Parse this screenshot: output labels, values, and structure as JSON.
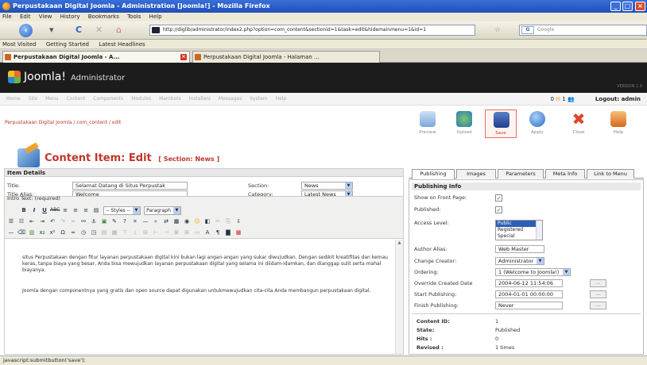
{
  "window": {
    "title": "Perpustakaan Digital Joomla - Administration [Joomla!] - Mozilla Firefox"
  },
  "menubar": [
    "File",
    "Edit",
    "View",
    "History",
    "Bookmarks",
    "Tools",
    "Help"
  ],
  "nav": {
    "url": "http://diglib/administrator/index2.php?option=com_content&sectionid=1&task=edit&hidemainmenu=1&id=1",
    "search_placeholder": "Google"
  },
  "bookmarks": [
    "Most Visited",
    "Getting Started",
    "Latest Headlines"
  ],
  "tabs": [
    {
      "label": "Perpustakaan Digital Joomla - A..."
    },
    {
      "label": "Perpustakaan Digital Joomla - Halaman ..."
    }
  ],
  "joomla": {
    "logo": "Joomla!",
    "subtitle": "Administrator",
    "version": "VERSION 1.0"
  },
  "admin_menu": [
    "Home",
    "Site",
    "Menu",
    "Content",
    "Components",
    "Modules",
    "Mambots",
    "Installers",
    "Messages",
    "System",
    "Help"
  ],
  "user_menu": {
    "messages": "0",
    "online": "1",
    "logout": "Logout: admin"
  },
  "breadcrumb": "Perpustakaan Digital Joomla / com_content / edit",
  "toolbar": {
    "preview": "Preview",
    "upload": "Upload",
    "save": "Save",
    "apply": "Apply",
    "close": "Close",
    "help": "Help"
  },
  "heading": {
    "title": "Content Item:",
    "mode": "Edit",
    "section": "[ Section: News ]"
  },
  "item_details": {
    "header": "Item Details",
    "title_label": "Title:",
    "title_value": "Selamat Datang di Situs Perpustak",
    "alias_label": "Title Alias:",
    "alias_value": "Welcome",
    "section_label": "Section:",
    "section_value": "News",
    "category_label": "Category:",
    "category_value": "Latest News",
    "intro_label": "Intro Text: (required)"
  },
  "editor": {
    "styles": "-- Styles --",
    "format": "Paragraph",
    "para1": "situs Perpustakaan dengan fitur layanan perpustakaan digital kini bukan lagi angan-angan yang sukar diwujudkan. Dengan sedikit kreatifitas dan kemau keras, tanpa biaya yang besar, Anda bisa mewujudkan layanan perpustakaan digital yang selama ini diidam-idamkan, dan dianggap sulit serta mahal biayanya.",
    "para2": "Joomla dengan componentnya yang gratis dan open source dapat digunakan untukmewujudkan cita-cita Anda membangun perpustakaan digital."
  },
  "right_tabs": [
    "Publishing",
    "Images",
    "Parameters",
    "Meta Info",
    "Link to Menu"
  ],
  "publishing": {
    "header": "Publishing Info",
    "front_label": "Show on Front Page:",
    "published_label": "Published:",
    "access_label": "Access Level:",
    "access_options": [
      "Public",
      "Registered",
      "Special"
    ],
    "author_alias_label": "Author Alias:",
    "author_alias_value": "Web Master",
    "creator_label": "Change Creator:",
    "creator_value": "Administrator",
    "ordering_label": "Ordering:",
    "ordering_value": "1 (Welcome to Joomla!)",
    "override_label": "Override Created Date",
    "override_value": "2004-06-12 11:54:06",
    "start_label": "Start Publishing:",
    "start_value": "2004-01-01 00:00:00",
    "finish_label": "Finish Publishing:",
    "finish_value": "Never",
    "dots": "..."
  },
  "content_info": {
    "id_label": "Content ID:",
    "id_value": "1",
    "state_label": "State:",
    "state_value": "Published",
    "hits_label": "Hits :",
    "hits_value": "0",
    "revised_label": "Revised :",
    "revised_value": "1 times"
  },
  "status": "javascript:submitbutton('save');"
}
